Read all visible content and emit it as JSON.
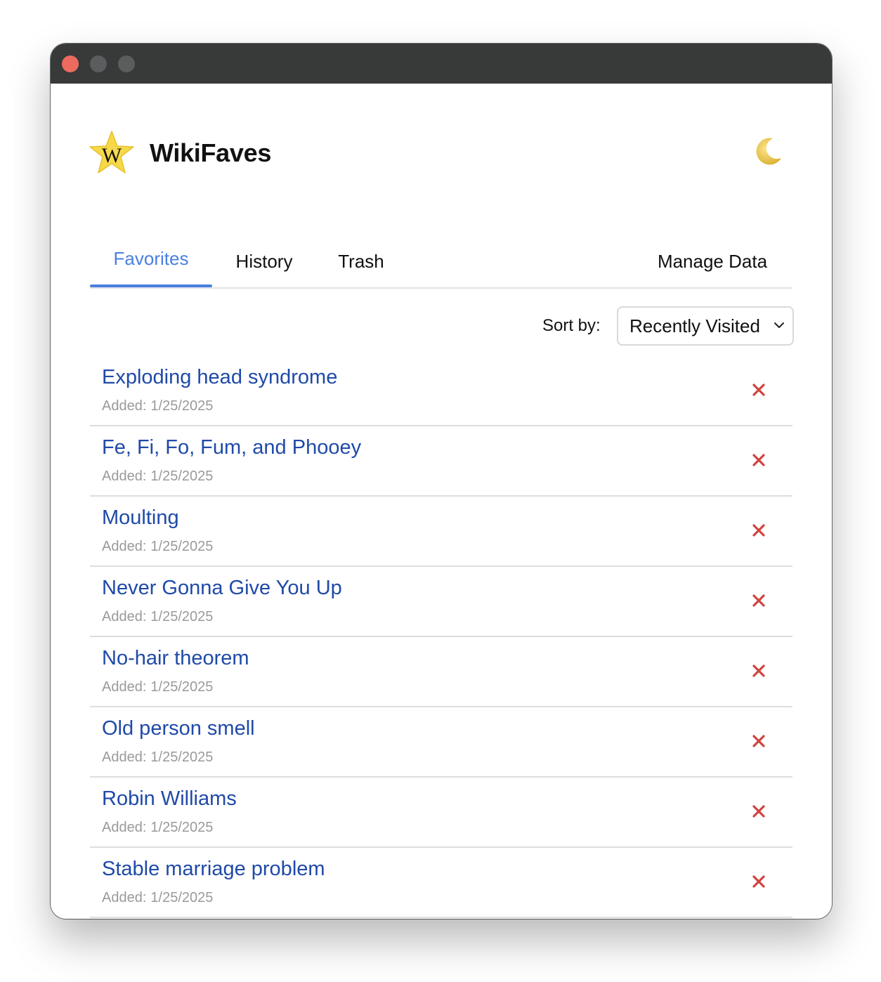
{
  "window": {
    "controls": [
      "close",
      "minimize",
      "maximize"
    ]
  },
  "header": {
    "title": "WikiFaves",
    "logo_letter": "W",
    "logo_icon": "star-w-logo-icon",
    "theme_icon": "moon-icon"
  },
  "tabs": [
    {
      "label": "Favorites",
      "active": true
    },
    {
      "label": "History",
      "active": false
    },
    {
      "label": "Trash",
      "active": false
    },
    {
      "label": "Manage Data",
      "active": false
    }
  ],
  "sort": {
    "label": "Sort by:",
    "selected": "Recently Visited"
  },
  "favorites": [
    {
      "title": "Exploding head syndrome",
      "added_label": "Added:",
      "date": "1/25/2025"
    },
    {
      "title": "Fe, Fi, Fo, Fum, and Phooey",
      "added_label": "Added:",
      "date": "1/25/2025"
    },
    {
      "title": "Moulting",
      "added_label": "Added:",
      "date": "1/25/2025"
    },
    {
      "title": "Never Gonna Give You Up",
      "added_label": "Added:",
      "date": "1/25/2025"
    },
    {
      "title": "No-hair theorem",
      "added_label": "Added:",
      "date": "1/25/2025"
    },
    {
      "title": "Old person smell",
      "added_label": "Added:",
      "date": "1/25/2025"
    },
    {
      "title": "Robin Williams",
      "added_label": "Added:",
      "date": "1/25/2025"
    },
    {
      "title": "Stable marriage problem",
      "added_label": "Added:",
      "date": "1/25/2025"
    }
  ],
  "colors": {
    "accent": "#4a7fe0",
    "link": "#1f4aa8",
    "delete": "#d0443f",
    "muted": "#9a9a9a",
    "titlebar": "#383939"
  }
}
